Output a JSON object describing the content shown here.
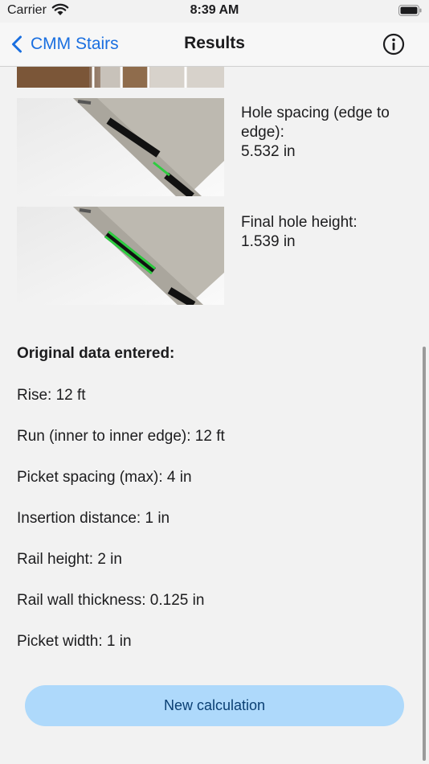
{
  "status_bar": {
    "carrier": "Carrier",
    "time": "8:39 AM"
  },
  "nav": {
    "back_label": "CMM Stairs",
    "title": "Results"
  },
  "results": [
    {
      "text": "Hole spacing (edge to edge):\n5.532 in"
    },
    {
      "text": "Final hole height:\n1.539 in"
    }
  ],
  "original": {
    "heading": "Original data entered:",
    "lines": [
      "Rise: 12 ft",
      "Run (inner to inner edge): 12 ft",
      "Picket spacing (max): 4 in",
      "Insertion distance: 1 in",
      "Rail height: 2 in",
      "Rail wall thickness: 0.125 in",
      "Picket width: 1 in"
    ]
  },
  "button": {
    "new_calc": "New calculation"
  },
  "colors": {
    "accent": "#1a6fe0",
    "button_bg": "#aed9fb",
    "measure_line": "#2ecc40"
  }
}
